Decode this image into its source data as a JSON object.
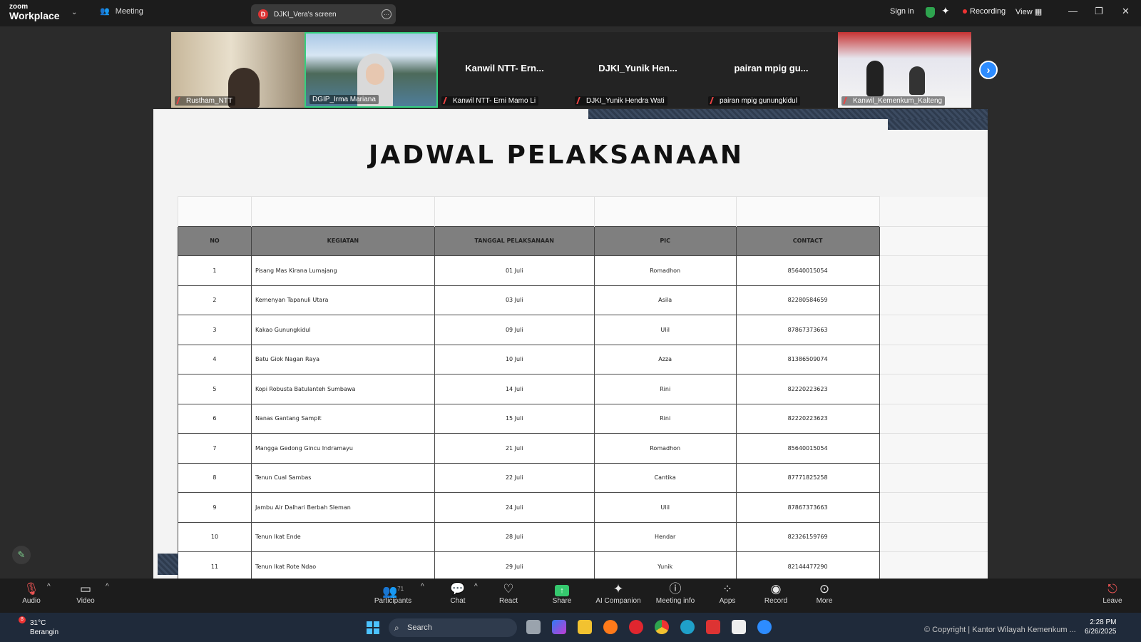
{
  "titlebar": {
    "logo_line1": "zoom",
    "logo_line2": "Workplace",
    "meeting_label": "Meeting",
    "screen_tab_badge": "D",
    "screen_tab_label": "DJKI_Vera's screen",
    "sign_in": "Sign in",
    "recording": "Recording",
    "view": "View"
  },
  "participants": [
    {
      "name": "Rustham_NTT",
      "big": ""
    },
    {
      "name": "DGIP_Irma Mariana",
      "big": ""
    },
    {
      "name": "Kanwil NTT- Erni Mamo Li",
      "big": "Kanwil NTT- Ern..."
    },
    {
      "name": "DJKI_Yunik Hendra Wati",
      "big": "DJKI_Yunik Hen..."
    },
    {
      "name": "pairan mpig gunungkidul",
      "big": "pairan mpig gu..."
    },
    {
      "name": "Kanwil_Kemenkum_Kalteng",
      "big": ""
    }
  ],
  "slide": {
    "title": "JADWAL PELAKSANAAN",
    "columns": [
      "NO",
      "KEGIATAN",
      "TANGGAL PELAKSANAAN",
      "PIC",
      "CONTACT"
    ],
    "rows": [
      {
        "no": "1",
        "kegiatan": "Pisang Mas Kirana Lumajang",
        "tanggal": "01 Juli",
        "pic": "Romadhon",
        "contact": "85640015054"
      },
      {
        "no": "2",
        "kegiatan": "Kemenyan Tapanuli Utara",
        "tanggal": "03 Juli",
        "pic": "Asila",
        "contact": "82280584659"
      },
      {
        "no": "3",
        "kegiatan": "Kakao Gunungkidul",
        "tanggal": "09 Juli",
        "pic": "Ulil",
        "contact": "87867373663"
      },
      {
        "no": "4",
        "kegiatan": "Batu Giok Nagan Raya",
        "tanggal": "10 Juli",
        "pic": "Azza",
        "contact": "81386509074"
      },
      {
        "no": "5",
        "kegiatan": "Kopi Robusta Batulanteh Sumbawa",
        "tanggal": "14 Juli",
        "pic": "Rini",
        "contact": "82220223623"
      },
      {
        "no": "6",
        "kegiatan": "Nanas Gantang Sampit",
        "tanggal": "15 Juli",
        "pic": "Rini",
        "contact": "82220223623"
      },
      {
        "no": "7",
        "kegiatan": "Mangga Gedong Gincu Indramayu",
        "tanggal": "21 Juli",
        "pic": "Romadhon",
        "contact": "85640015054"
      },
      {
        "no": "8",
        "kegiatan": "Tenun Cual Sambas",
        "tanggal": "22 Juli",
        "pic": "Cantika",
        "contact": "87771825258"
      },
      {
        "no": "9",
        "kegiatan": "Jambu Air Dalhari Berbah Sleman",
        "tanggal": "24 Juli",
        "pic": "Ulil",
        "contact": "87867373663"
      },
      {
        "no": "10",
        "kegiatan": "Tenun Ikat Ende",
        "tanggal": "28 Juli",
        "pic": "Hendar",
        "contact": "82326159769"
      },
      {
        "no": "11",
        "kegiatan": "Tenun Ikat Rote Ndao",
        "tanggal": "29 Juli",
        "pic": "Yunik",
        "contact": "82144477290"
      }
    ]
  },
  "toolbar": {
    "audio": "Audio",
    "video": "Video",
    "participants": "Participants",
    "participant_count": "71",
    "chat": "Chat",
    "react": "React",
    "share": "Share",
    "ai_companion": "AI Companion",
    "meeting_info": "Meeting info",
    "apps": "Apps",
    "record": "Record",
    "more": "More",
    "leave": "Leave"
  },
  "taskbar": {
    "weather_badge": "8",
    "temperature": "31°C",
    "weather_text": "Berangin",
    "search": "Search",
    "copyright": "© Copyright | Kantor Wilayah Kemenkum ...",
    "time": "2:28 PM",
    "date": "6/26/2025"
  }
}
